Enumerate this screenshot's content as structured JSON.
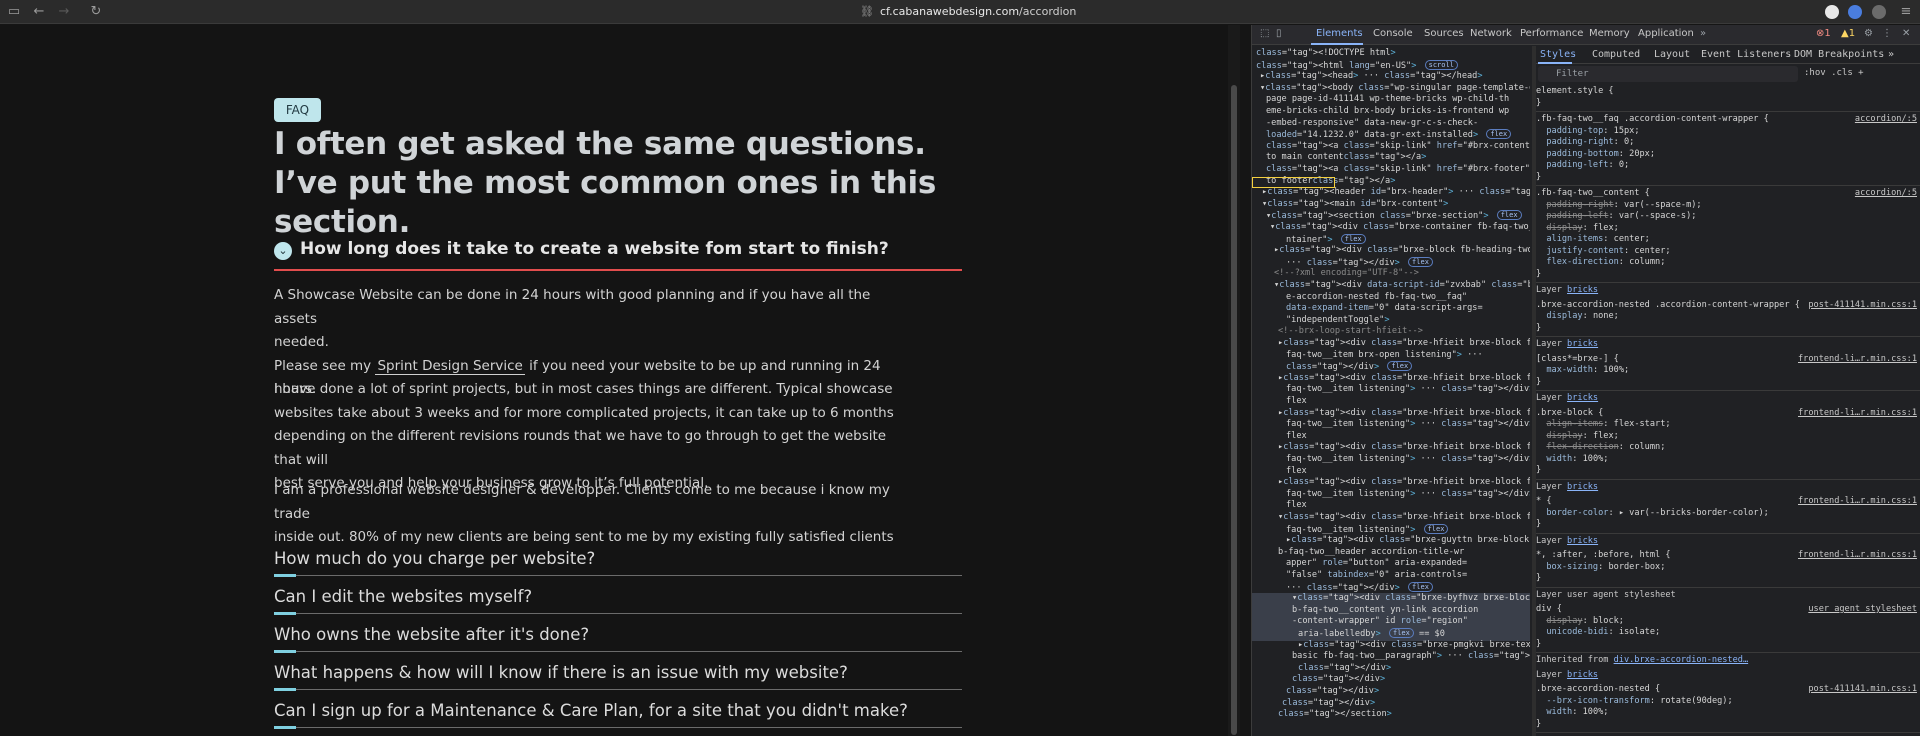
{
  "browser": {
    "url_domain": "cf.cabanawebdesign.com",
    "url_path": "/accordion",
    "error_count": "1",
    "warning_count": "1"
  },
  "page": {
    "badge": "FAQ",
    "heading_line1": "I often get asked the same questions.",
    "heading_line2": "I’ve put the most common ones in this section.",
    "open_question": "How long does it take to create a website fom start to finish?",
    "answer": {
      "p1_line1": "A Showcase Website can be done in 24 hours with good planning and if you have all the assets",
      "p1_line2": "needed.",
      "p1_line3_before": "Please see my",
      "p1_link": "Sprint Design Service",
      "p1_line3_after": "if you need your website to be up and running in 24 hours.",
      "p2_line1": "I have done a lot of sprint projects, but in most cases things are different. Typical showcase",
      "p2_line2": "websites take about 3 weeks and for more complicated projects, it can take up to 6 months",
      "p2_line3": "depending on the different revisions rounds that we have to go through to get the website that will",
      "p2_line4": "best serve you and help your business grow to it’s full potential.",
      "p3_line1": "I am a professional website designer & developper. Clients come to me because i know my trade",
      "p3_line2": "inside out. 80% of my new clients are being sent to me by my existing fully satisfied clients"
    },
    "questions": [
      "How much do you charge per website?",
      "Can I edit the websites myself?",
      "Who owns the website after it's done?",
      "What happens & how will I know if there is an issue with my website?",
      "Can I sign up for a Maintenance & Care Plan, for a site that you didn't make?"
    ]
  },
  "devtools": {
    "tabs": [
      "Elements",
      "Console",
      "Sources",
      "Network",
      "Performance",
      "Memory",
      "Application"
    ],
    "styles_tabs": [
      "Styles",
      "Computed",
      "Layout",
      "Event Listeners",
      "DOM Breakpoints"
    ],
    "filter_placeholder": "Filter",
    "filter_tools": ":hov  .cls  +",
    "elements_lines": [
      "<!DOCTYPE html>",
      "<html lang=\"en-US\"> scroll",
      "▸<head> ··· </head>",
      "▾<body class=\"wp-singular page-template-default",
      "page page-id-411141 wp-theme-bricks wp-child-th",
      "eme-bricks-child brx-body bricks-is-frontend wp",
      "-embed-responsive\" data-new-gr-c-s-check-",
      "loaded=\"14.1232.0\" data-gr-ext-installed> flex",
      "<a class=\"skip-link\" href=\"#brx-content\">Skip",
      "to main content</a>",
      "<a class=\"skip-link\" href=\"#brx-footer\">Skip",
      "to footer</a>",
      "▸<header id=\"brx-header\"> ··· </header>",
      "▾<main id=\"brx-content\">",
      "▾<section class=\"brxe-section\"> flex",
      "▾<div class=\"brxe-container fb-faq-two__co",
      "ntainer\"> flex",
      "▸<div class=\"brxe-block fb-heading-two\">",
      "··· </div> flex",
      "<!--?xml encoding=\"UTF-8\"-->",
      "▾<div data-script-id=\"zvxbab\" class=\"brx",
      "e-accordion-nested fb-faq-two__faq\"",
      "data-expand-item=\"0\" data-script-args=",
      "\"independentToggle\">",
      "<!--brx-loop-start-hfieit-->",
      "▸<div class=\"brxe-hfieit brxe-block fb-",
      "faq-two__item brx-open listening\"> ···",
      "</div> flex",
      "▸<div class=\"brxe-hfieit brxe-block fb-",
      "faq-two__item listening\"> ··· </div>",
      "flex",
      "▸<div class=\"brxe-hfieit brxe-block fb-",
      "faq-two__item listening\"> ··· </div>",
      "flex",
      "▸<div class=\"brxe-hfieit brxe-block fb-",
      "faq-two__item listening\"> ··· </div>",
      "flex",
      "▸<div class=\"brxe-hfieit brxe-block fb-",
      "faq-two__item listening\"> ··· </div>",
      "flex",
      "▾<div class=\"brxe-hfieit brxe-block fb-",
      "faq-two__item listening\"> flex",
      "▸<div class=\"brxe-guyttn brxe-block f",
      "b-faq-two__header accordion-title-wr",
      "apper\" role=\"button\" aria-expanded=",
      "\"false\" tabindex=\"0\" aria-controls=",
      "··· </div> flex",
      "▾<div class=\"brxe-byfhvz brxe-block fb",
      "b-faq-two__content yn-link accordion",
      "-content-wrapper\" id role=\"region\"",
      "aria-labelledby> flex == $0",
      "▸<div class=\"brxe-pmgkvi brxe-text-",
      "basic fb-faq-two__paragraph\"> ··· </div>",
      "</div>",
      "</div>",
      "</div>",
      "</div>",
      "</section>"
    ],
    "styles": {
      "element_style": "element.style {",
      "rule1_selector": ".fb-faq-two__faq .accordion-content-wrapper {",
      "rule1_source": "accordion/:5",
      "rule1_props": [
        "padding-top: 15px;",
        "padding-right: 0;",
        "padding-bottom: 20px;",
        "padding-left: 0;"
      ],
      "rule2_selector": ".fb-faq-two__content {",
      "rule2_source": "accordion/:5",
      "rule2_props_struck": [
        "padding-right: var(--space-m);",
        "padding-left: var(--space-s);",
        "display: flex;"
      ],
      "rule2_props": [
        "align-items: center;",
        "justify-content: center;",
        "flex-direction: column;"
      ],
      "layer_label": "Layer",
      "layer_name": "bricks",
      "rule3_selector": ".brxe-accordion-nested .accordion-content-wrapper {",
      "rule3_source": "post-411141.min.css:1",
      "rule3_props": [
        "display: none;"
      ],
      "rule4_selector": "[class*=brxe-] {",
      "rule4_source": "frontend-li…r.min.css:1",
      "rule4_props": [
        "max-width: 100%;"
      ],
      "rule5_selector": ".brxe-block {",
      "rule5_source": "frontend-li…r.min.css:1",
      "rule5_props_struck": [
        "align-items: flex-start;",
        "display: flex;",
        "flex-direction: column;"
      ],
      "rule5_props": [
        "width: 100%;"
      ],
      "rule6_selector": "* {",
      "rule6_source": "frontend-li…r.min.css:1",
      "rule6_props": [
        "border-color: ▸ var(--bricks-border-color);"
      ],
      "rule7_selector": "*, :after, :before, html {",
      "rule7_source": "frontend-li…r.min.css:1",
      "rule7_props": [
        "box-sizing: border-box;"
      ],
      "ua_header": "Layer user agent stylesheet",
      "rule8_selector": "div {",
      "rule8_source": "user agent stylesheet",
      "rule8_props_struck": [
        "display: block;"
      ],
      "rule8_props": [
        "unicode-bidi: isolate;"
      ],
      "inherited_label": "Inherited from",
      "inherited_from": "div.brxe-accordion-nested…",
      "rule9_selector": ".brxe-accordion-nested {",
      "rule9_source": "post-411141.min.css:1",
      "rule9_props": [
        "--brx-icon-transform: rotate(90deg);",
        "width: 100%;"
      ]
    }
  }
}
